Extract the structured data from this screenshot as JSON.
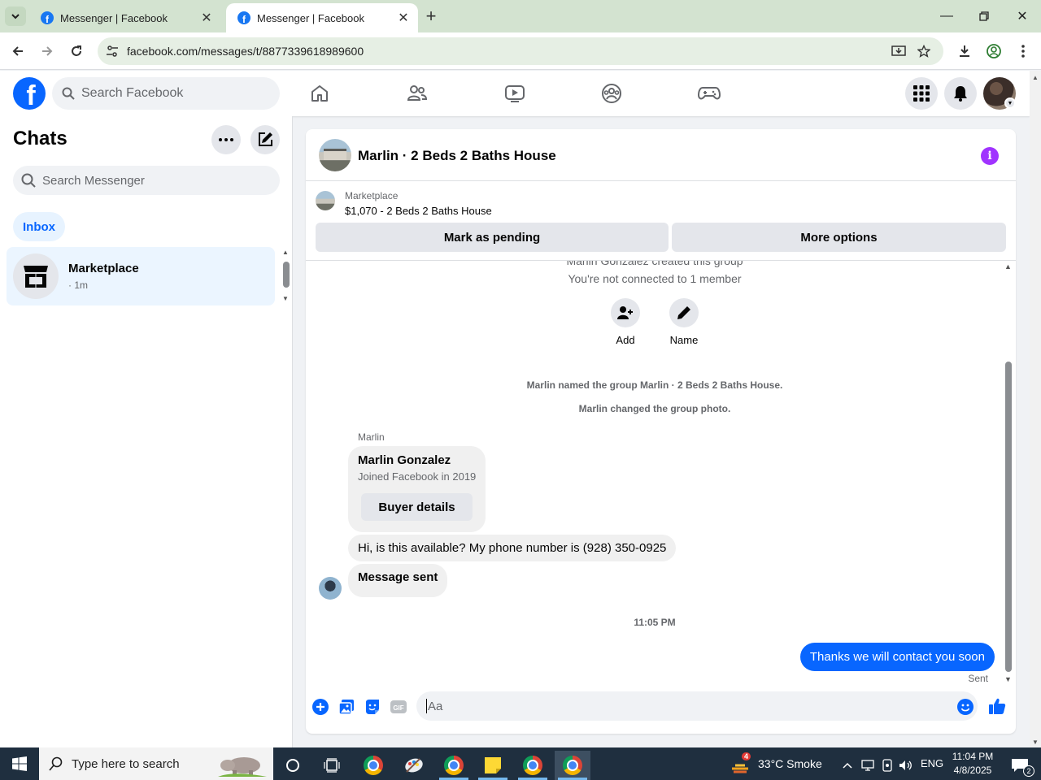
{
  "browser": {
    "tabs": [
      {
        "title": "Messenger | Facebook"
      },
      {
        "title": "Messenger | Facebook"
      }
    ],
    "url": "facebook.com/messages/t/8877339618989600"
  },
  "facebook": {
    "search_placeholder": "Search Facebook",
    "logo_letter": "f"
  },
  "chats": {
    "title": "Chats",
    "search_placeholder": "Search Messenger",
    "filter": "Inbox",
    "items": [
      {
        "name": "Marketplace",
        "time": "· 1m"
      }
    ]
  },
  "conversation": {
    "title": "Marlin · 2 Beds 2 Baths House",
    "info_glyph": "i",
    "listing": {
      "source": "Marketplace",
      "title": "$1,070 - 2 Beds 2 Baths House",
      "buttons": [
        "Mark as pending",
        "More options"
      ]
    },
    "system": {
      "created": "Marlin Gonzalez created this group",
      "not_connected": "You're not connected to 1 member",
      "actions": [
        "Add",
        "Name"
      ],
      "named": "Marlin named the group Marlin · 2 Beds 2 Baths House.",
      "photo": "Marlin changed the group photo."
    },
    "sender_label": "Marlin",
    "profile_card": {
      "name": "Marlin Gonzalez",
      "joined": "Joined Facebook in 2019",
      "button": "Buyer details"
    },
    "messages": [
      {
        "text": "Hi, is this available? My phone number is (928) 350-0925"
      },
      {
        "text": "Message sent"
      }
    ],
    "timestamp": "11:05 PM",
    "my_message": "Thanks we will contact you soon",
    "status": "Sent",
    "composer_placeholder": "Aa"
  },
  "taskbar": {
    "search_placeholder": "Type here to search",
    "weather": "33°C  Smoke",
    "weather_badge": "4",
    "language": "ENG",
    "time": "11:04 PM",
    "date": "4/8/2025",
    "notifications": "2"
  },
  "colors": {
    "facebook_blue": "#0866ff",
    "info_purple": "#a033ff",
    "taskbar": "#1f2f3f"
  }
}
